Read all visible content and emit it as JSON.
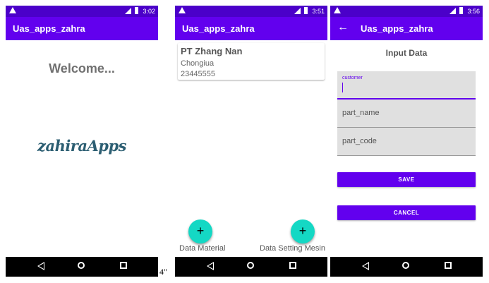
{
  "screens": [
    {
      "status_time": "3:02",
      "app_title": "Uas_apps_zahra",
      "welcome": "Welcome...",
      "logo_text": "zahiraApps"
    },
    {
      "status_time": "3:51",
      "app_title": "Uas_apps_zahra",
      "card": {
        "name": "PT Zhang Nan",
        "city": "Chongiua",
        "phone": "23445555"
      },
      "fabs": [
        {
          "icon": "+",
          "label": "Data Material"
        },
        {
          "icon": "+",
          "label": "Data Setting Mesin"
        }
      ]
    },
    {
      "status_time": "3:56",
      "app_title": "Uas_apps_zahra",
      "back_icon": "←",
      "heading": "Input Data",
      "fields": [
        {
          "label": "customer",
          "value": ""
        },
        {
          "placeholder": "part_name"
        },
        {
          "placeholder": "part_code"
        }
      ],
      "save_label": "SAVE",
      "cancel_label": "CANCEL"
    }
  ],
  "stray_text": "4\"",
  "colors": {
    "status_bar": "#4b00c9",
    "app_bar": "#6200ee",
    "fab": "#14d8c4",
    "button": "#6200ee"
  },
  "icons": [
    "warning-icon",
    "signal-icon",
    "battery-icon",
    "nav-back-icon",
    "nav-home-icon",
    "nav-recents-icon",
    "add-icon",
    "arrow-back-icon"
  ]
}
